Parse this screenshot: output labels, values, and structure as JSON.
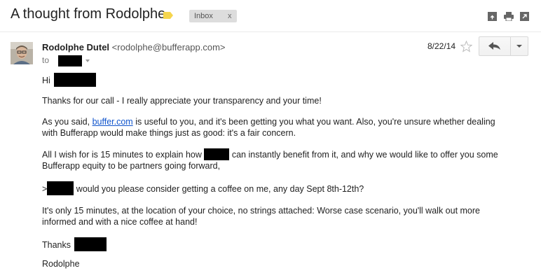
{
  "header": {
    "subject": "A thought from Rodolphe",
    "label_chip": "Inbox",
    "label_chip_close": "x",
    "label_color": "#f5d54e"
  },
  "message": {
    "sender_name": "Rodolphe Dutel",
    "sender_email": "<rodolphe@bufferapp.com>",
    "to_label": "to",
    "date": "8/22/14"
  },
  "body": {
    "greeting": "Hi",
    "p1": "Thanks for our call - I really appreciate your transparency and your time!",
    "p2_before": "As you said, ",
    "p2_link": "buffer.com",
    "p2_after": " is useful to you, and it's been getting you what you want. Also, you're unsure whether dealing",
    "p2_line2": "with Bufferapp would make things just as good: it's a fair concern.",
    "p3_before": "All I wish for is 15 minutes to explain how",
    "p3_after": "can instantly benefit from it, and why we would like to offer you some",
    "p3_line2": "Bufferapp equity to be partners going forward,",
    "p4_prefix": ">",
    "p4_after": "would you please consider getting a coffee on me, any day Sept 8th-12th?",
    "p5_line1": "It's only 15 minutes, at the location of your choice, no strings attached: Worse case scenario, you'll walk out more",
    "p5_line2": "informed and with a nice coffee at hand!",
    "p6": "Thanks",
    "signature": "Rodolphe"
  },
  "icons": {
    "label": "label-tag-icon",
    "print": "print-icon",
    "new_window": "new-window-icon",
    "expand": "expand-icon",
    "star": "star-icon",
    "reply": "reply-icon",
    "more": "chevron-down-icon"
  }
}
